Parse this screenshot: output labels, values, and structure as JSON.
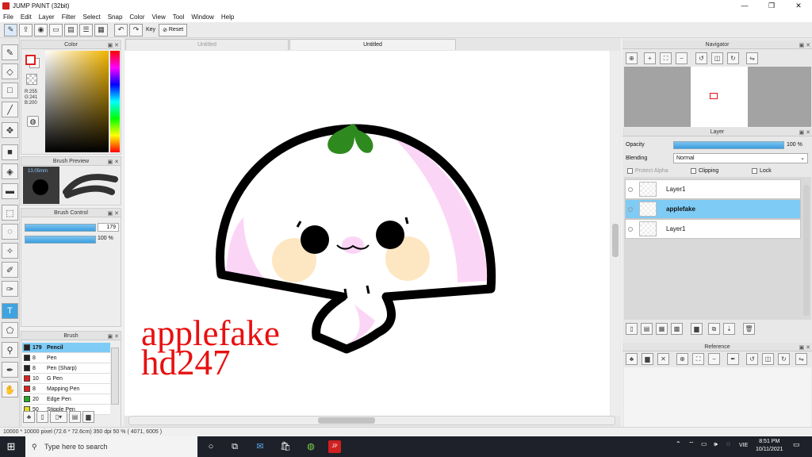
{
  "window": {
    "title": "JUMP PAINT (32bit)"
  },
  "menu": [
    "File",
    "Edit",
    "Layer",
    "Filter",
    "Select",
    "Snap",
    "Color",
    "View",
    "Tool",
    "Window",
    "Help"
  ],
  "toolbar": {
    "key_label": "Key",
    "reset_label": "Reset"
  },
  "color_panel": {
    "title": "Color",
    "r": "R:255",
    "g": "G:241",
    "b": "B:200"
  },
  "brush_preview": {
    "title": "Brush Preview",
    "size": "13.05mm"
  },
  "brush_control": {
    "title": "Brush Control",
    "size_value": "179",
    "opacity_value": "100 %"
  },
  "brush_panel": {
    "title": "Brush",
    "items": [
      {
        "size": "179",
        "name": "Pencil",
        "color": "#222222"
      },
      {
        "size": "8",
        "name": "Pen",
        "color": "#222222"
      },
      {
        "size": "8",
        "name": "Pen (Sharp)",
        "color": "#222222"
      },
      {
        "size": "10",
        "name": "G Pen",
        "color": "#e02020"
      },
      {
        "size": "8",
        "name": "Mapping Pen",
        "color": "#e02020"
      },
      {
        "size": "20",
        "name": "Edge Pen",
        "color": "#22aa22"
      },
      {
        "size": "50",
        "name": "Stipple Pen",
        "color": "#dddd22"
      }
    ]
  },
  "tabs": [
    "Untitled",
    "Untitled"
  ],
  "watermark": {
    "line1": "applefake",
    "line2": "hd247"
  },
  "navigator": {
    "title": "Navigator"
  },
  "layer_panel": {
    "title": "Layer",
    "opacity_label": "Opacity",
    "opacity_value": "100 %",
    "blending_label": "Blending",
    "blending_value": "Normal",
    "protect_alpha": "Protect Alpha",
    "clipping": "Clipping",
    "lock": "Lock",
    "layers": [
      {
        "name": "Layer1",
        "selected": false
      },
      {
        "name": "applefake",
        "selected": true
      },
      {
        "name": "Layer1",
        "selected": false
      }
    ]
  },
  "reference": {
    "title": "Reference"
  },
  "status": {
    "text": "10000 * 10000 pixel  (72.6 * 72.6cm)  350 dpi  50 %  ( 4071, 6005 )"
  },
  "taskbar": {
    "search_placeholder": "Type here to search",
    "lang": "VIE",
    "time": "8:51 PM",
    "date": "10/11/2021"
  }
}
